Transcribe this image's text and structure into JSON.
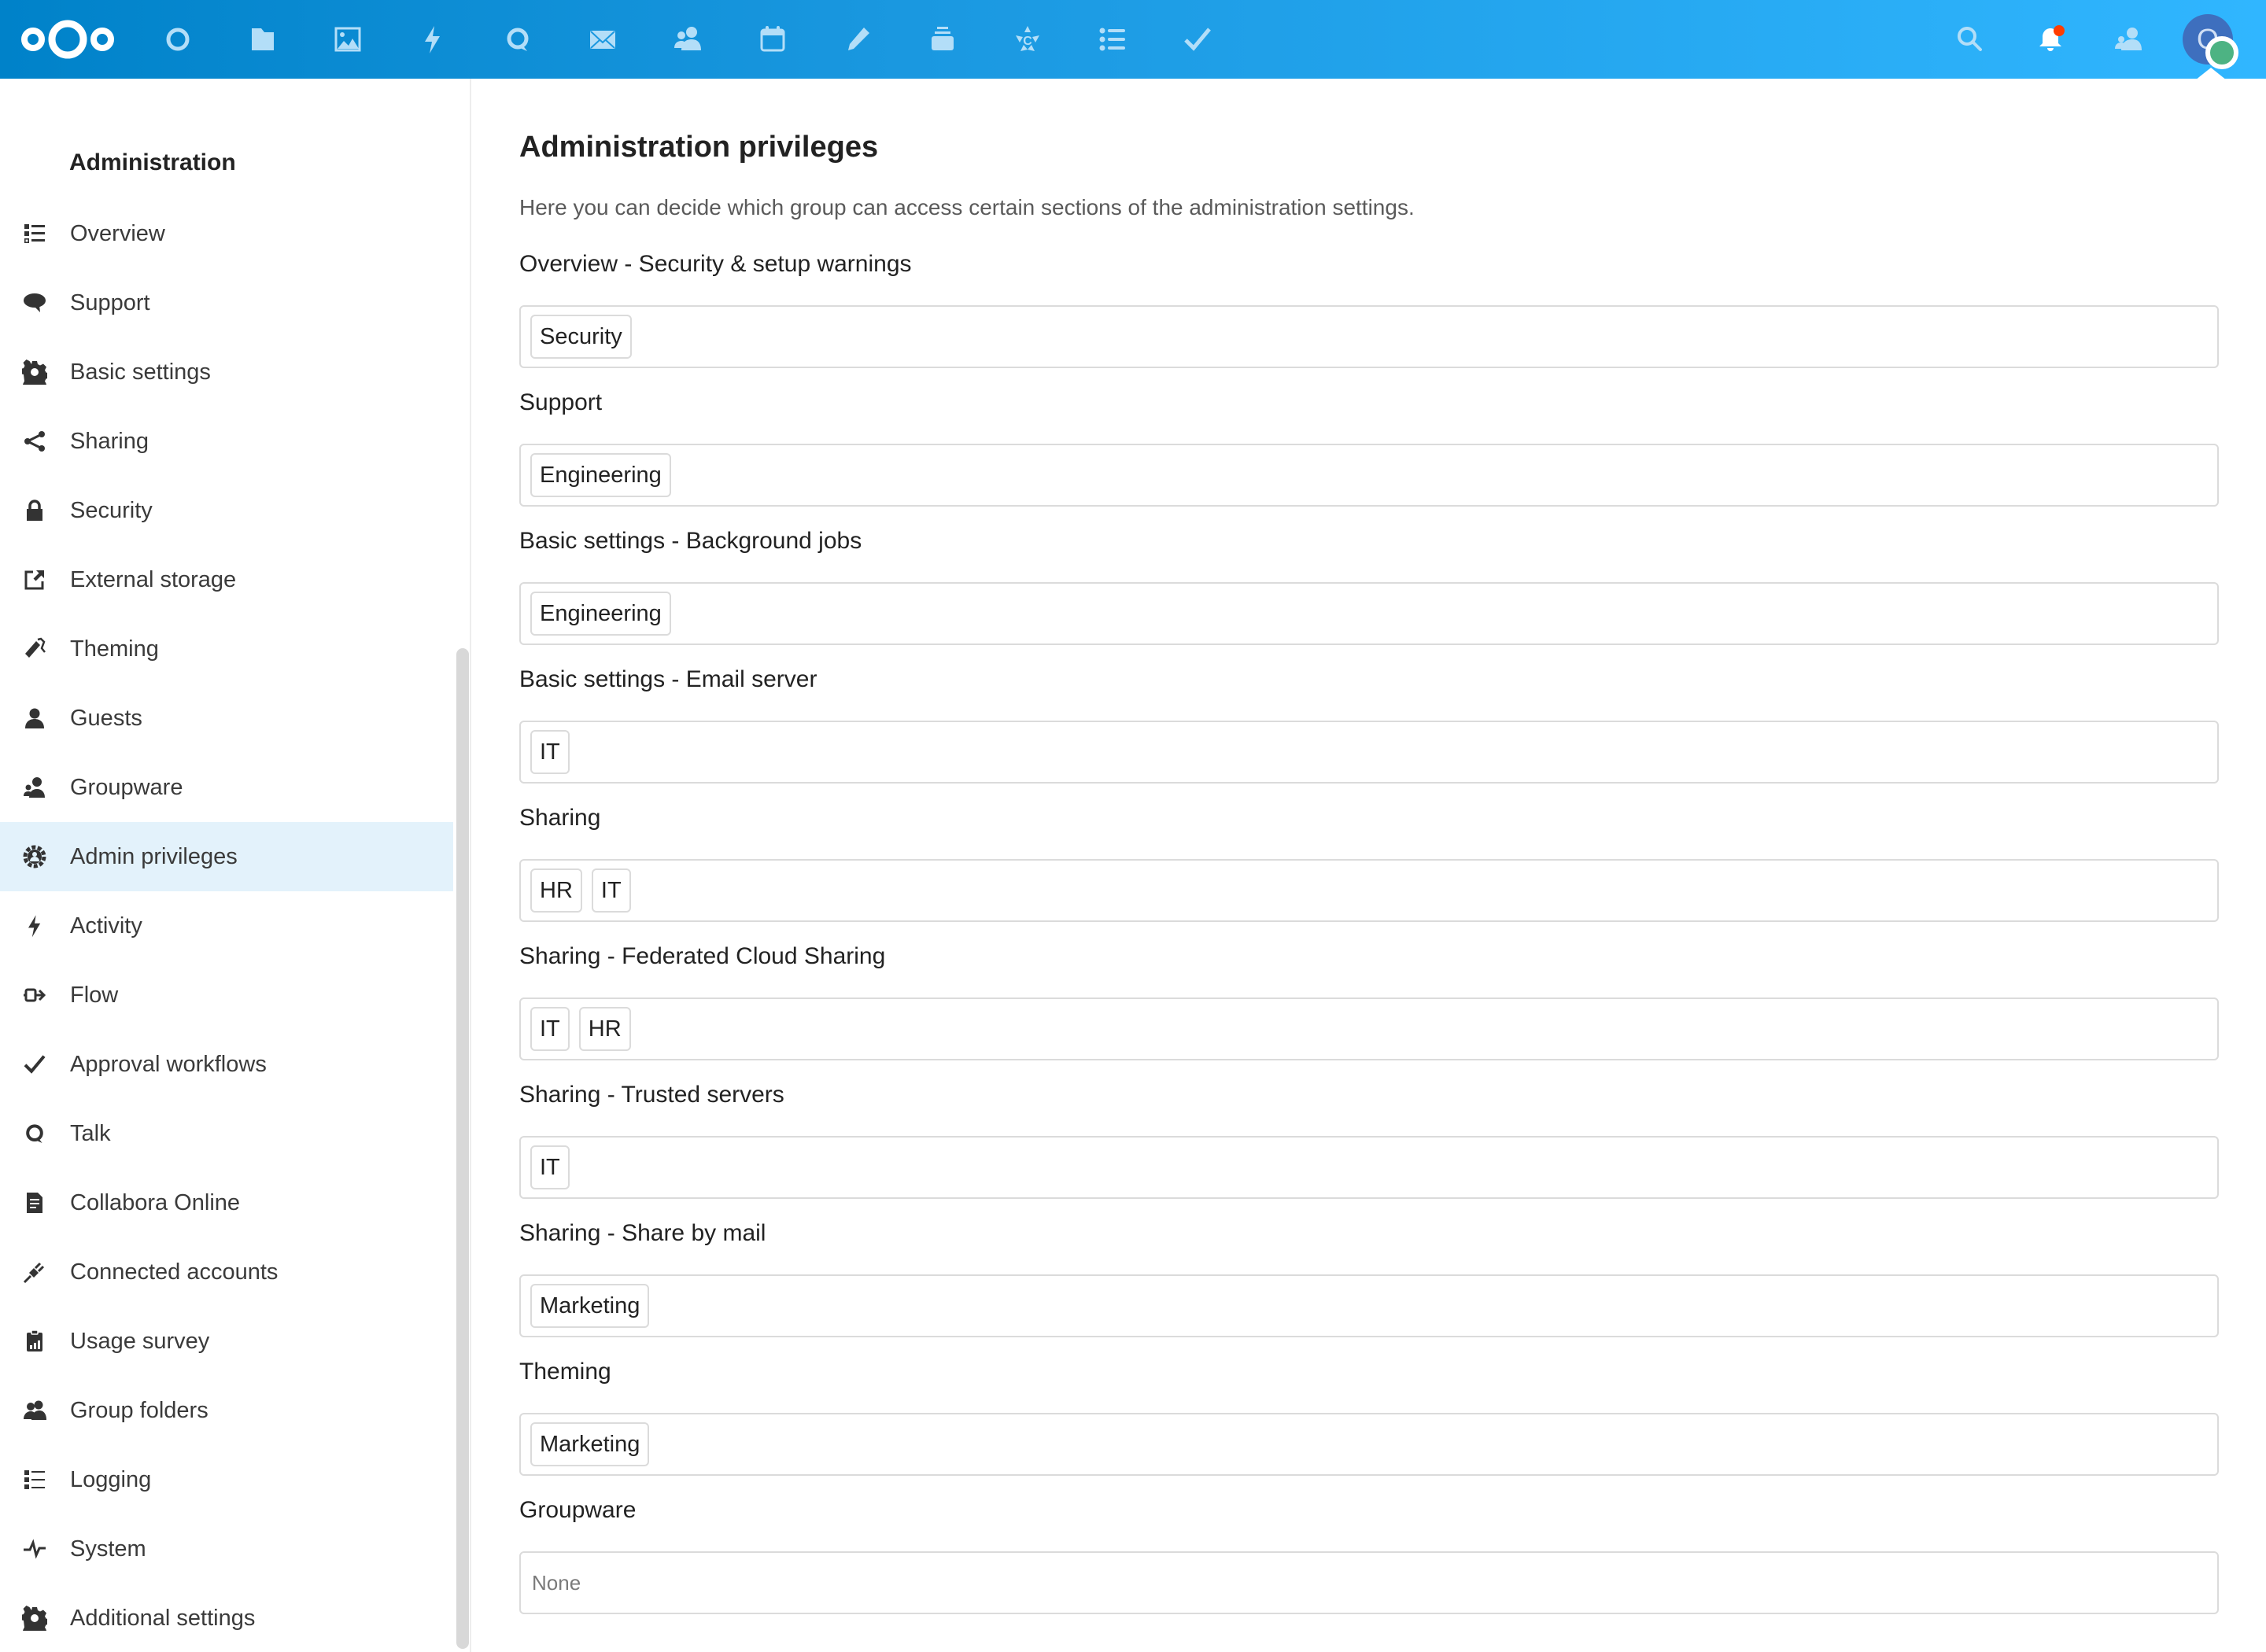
{
  "header": {
    "logo": "nextcloud-logo",
    "apps": [
      {
        "name": "dashboard",
        "icon": "circle-icon"
      },
      {
        "name": "files",
        "icon": "folder-icon"
      },
      {
        "name": "photos",
        "icon": "image-icon"
      },
      {
        "name": "activity",
        "icon": "lightning-icon"
      },
      {
        "name": "talk",
        "icon": "talk-icon"
      },
      {
        "name": "mail",
        "icon": "mail-icon"
      },
      {
        "name": "contacts",
        "icon": "contacts-icon"
      },
      {
        "name": "calendar",
        "icon": "calendar-icon"
      },
      {
        "name": "notes",
        "icon": "pencil-icon"
      },
      {
        "name": "deck",
        "icon": "deck-icon"
      },
      {
        "name": "collectives",
        "icon": "collectives-icon"
      },
      {
        "name": "tasks",
        "icon": "list-icon"
      },
      {
        "name": "approval",
        "icon": "checkmark-icon"
      }
    ],
    "right": {
      "search": "search-icon",
      "notifications": "bell-icon",
      "contacts_menu": "contacts-menu-icon",
      "avatar_initial": "O"
    },
    "colors": {
      "gradient_start": "#0082c9",
      "gradient_end": "#30b6ff",
      "notification_dot": "#ff3d00",
      "status_online": "#4db383",
      "avatar": "#3e6fbe"
    }
  },
  "sidebar": {
    "heading": "Administration",
    "active_color": "#e3f2fb",
    "items": [
      {
        "label": "Overview",
        "icon": "overview-list-icon",
        "active": false
      },
      {
        "label": "Support",
        "icon": "speech-bubble-icon",
        "active": false
      },
      {
        "label": "Basic settings",
        "icon": "gear-icon",
        "active": false
      },
      {
        "label": "Sharing",
        "icon": "share-icon",
        "active": false
      },
      {
        "label": "Security",
        "icon": "lock-icon",
        "active": false
      },
      {
        "label": "External storage",
        "icon": "external-link-icon",
        "active": false
      },
      {
        "label": "Theming",
        "icon": "paint-roller-icon",
        "active": false
      },
      {
        "label": "Guests",
        "icon": "user-icon",
        "active": false
      },
      {
        "label": "Groupware",
        "icon": "group-icon",
        "active": false
      },
      {
        "label": "Admin privileges",
        "icon": "admin-gear-icon",
        "active": true
      },
      {
        "label": "Activity",
        "icon": "lightning-icon",
        "active": false
      },
      {
        "label": "Flow",
        "icon": "flow-icon",
        "active": false
      },
      {
        "label": "Approval workflows",
        "icon": "checkmark-icon",
        "active": false
      },
      {
        "label": "Talk",
        "icon": "talk-icon",
        "active": false
      },
      {
        "label": "Collabora Online",
        "icon": "document-icon",
        "active": false
      },
      {
        "label": "Connected accounts",
        "icon": "plug-icon",
        "active": false
      },
      {
        "label": "Usage survey",
        "icon": "clipboard-chart-icon",
        "active": false
      },
      {
        "label": "Group folders",
        "icon": "group-folders-icon",
        "active": false
      },
      {
        "label": "Logging",
        "icon": "logging-list-icon",
        "active": false
      },
      {
        "label": "System",
        "icon": "pulse-icon",
        "active": false
      },
      {
        "label": "Additional settings",
        "icon": "gear-icon",
        "active": false
      }
    ]
  },
  "main": {
    "title": "Administration privileges",
    "description": "Here you can decide which group can access certain sections of the administration settings.",
    "sections": [
      {
        "label": "Overview - Security & setup warnings",
        "groups": [
          "Security"
        ]
      },
      {
        "label": "Support",
        "groups": [
          "Engineering"
        ]
      },
      {
        "label": "Basic settings - Background jobs",
        "groups": [
          "Engineering"
        ]
      },
      {
        "label": "Basic settings - Email server",
        "groups": [
          "IT"
        ]
      },
      {
        "label": "Sharing",
        "groups": [
          "HR",
          "IT"
        ]
      },
      {
        "label": "Sharing - Federated Cloud Sharing",
        "groups": [
          "IT",
          "HR"
        ]
      },
      {
        "label": "Sharing - Trusted servers",
        "groups": [
          "IT"
        ]
      },
      {
        "label": "Sharing - Share by mail",
        "groups": [
          "Marketing"
        ]
      },
      {
        "label": "Theming",
        "groups": [
          "Marketing"
        ]
      },
      {
        "label": "Groupware",
        "groups": [],
        "placeholder": "None"
      }
    ]
  }
}
